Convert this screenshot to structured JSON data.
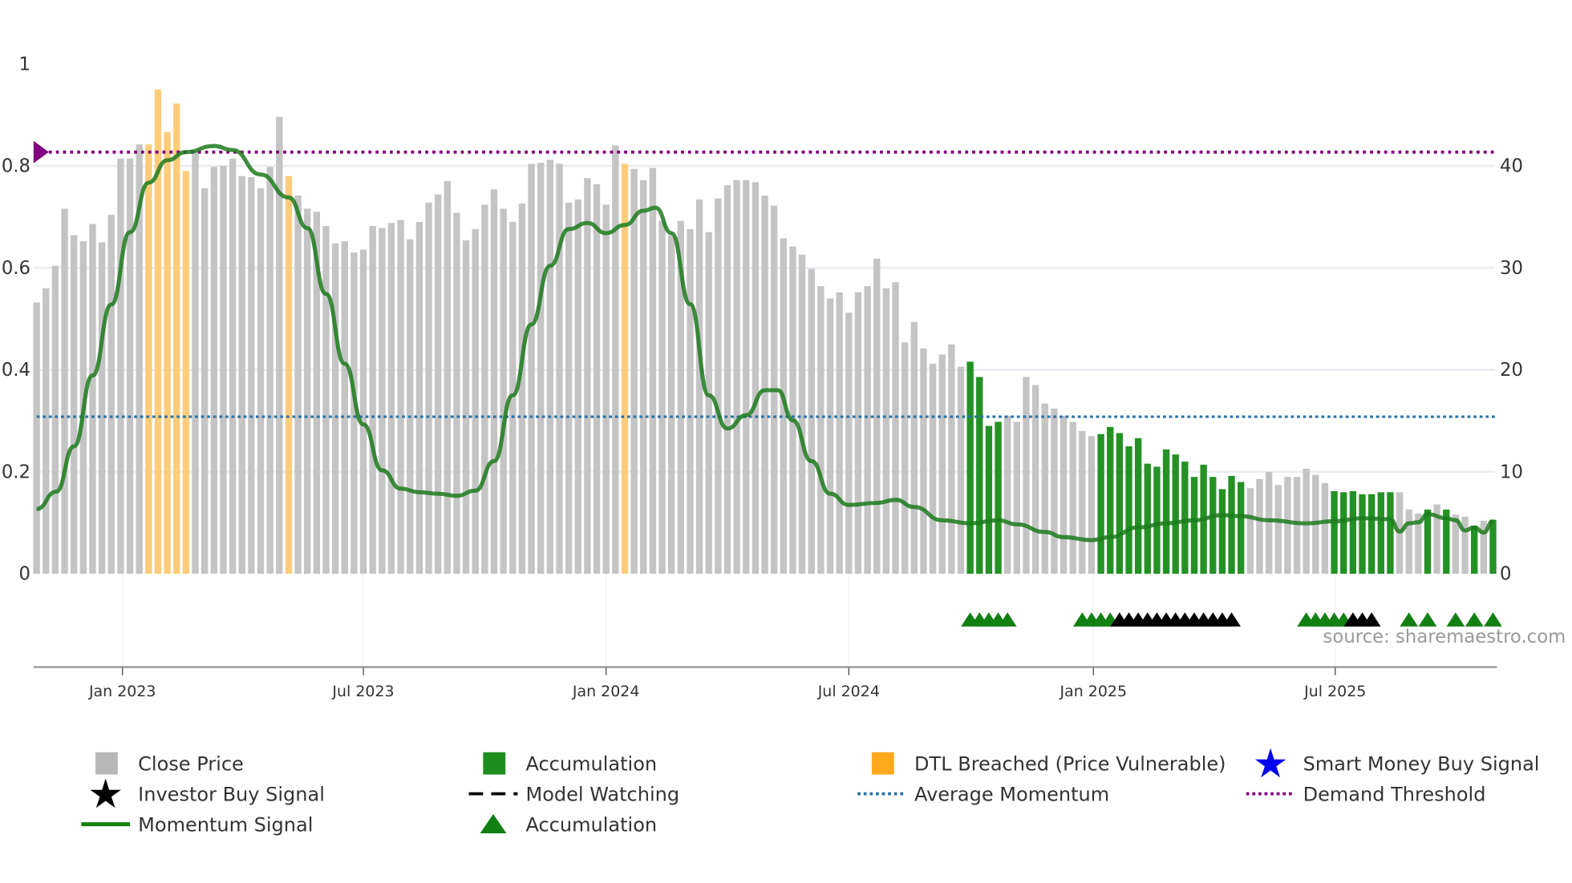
{
  "chart_data": {
    "type": "bar",
    "title": "",
    "source": "source: sharemaestro.com",
    "left_axis": {
      "ylim": [
        0,
        1
      ],
      "ticks": [
        "0",
        "0.2",
        "0.4",
        "0.6",
        "0.8",
        "1"
      ]
    },
    "right_axis": {
      "ylim": [
        0,
        50
      ],
      "ticks": [
        "0",
        "10",
        "20",
        "30",
        "40"
      ]
    },
    "x_axis": {
      "unit": "week index from first bar",
      "ticks": [
        {
          "label": "Jan 2023",
          "x": 9.2
        },
        {
          "label": "Jul 2023",
          "x": 35
        },
        {
          "label": "Jan 2024",
          "x": 61
        },
        {
          "label": "Jul 2024",
          "x": 87
        },
        {
          "label": "Jan 2025",
          "x": 113.2
        },
        {
          "label": "Jul 2025",
          "x": 139.1
        }
      ]
    },
    "close_price": [
      26.6,
      28,
      30.2,
      35.8,
      33.2,
      32.6,
      34.3,
      32.5,
      35.2,
      40.7,
      40.7,
      42.1,
      42.1,
      47.5,
      43.3,
      46.1,
      39.5,
      41.4,
      37.8,
      39.9,
      40,
      40.7,
      39,
      38.9,
      37.8,
      39.9,
      44.8,
      39,
      37.1,
      35.8,
      35.5,
      34.1,
      32.4,
      32.6,
      31.5,
      31.8,
      34.1,
      33.9,
      34.4,
      34.7,
      32.8,
      34.5,
      36.4,
      37.2,
      38.5,
      35.4,
      32.7,
      33.8,
      36.2,
      37.7,
      35.8,
      34.5,
      36.3,
      40.2,
      40.3,
      40.6,
      40.2,
      36.4,
      36.7,
      38.8,
      38.2,
      36.2,
      42,
      40.2,
      39.7,
      38.6,
      39.8,
      34.6,
      33.2,
      34.6,
      33.8,
      36.7,
      33.5,
      36.8,
      38.1,
      38.6,
      38.6,
      38.4,
      37.1,
      36.1,
      32.9,
      32.1,
      31.3,
      29.9,
      28.2,
      27,
      27.6,
      25.6,
      27.6,
      28.2,
      30.9,
      28,
      28.6,
      22.7,
      24.7,
      22.1,
      20.6,
      21.5,
      22.5,
      20.3,
      20.8,
      19.3,
      14.5,
      14.9,
      15.5,
      14.9,
      19.3,
      18.5,
      16.7,
      16.2,
      15.5,
      14.9,
      14,
      13.5,
      13.7,
      14.4,
      13.8,
      12.5,
      13.3,
      10.8,
      10.5,
      12.2,
      11.7,
      11,
      9.5,
      10.7,
      9.5,
      8.3,
      9.6,
      9,
      8.4,
      9.3,
      10,
      8.7,
      9.5,
      9.5,
      10.3,
      9.7,
      8.9,
      8.1,
      8,
      8.1,
      7.8,
      7.8,
      8,
      8,
      8,
      6.3,
      5.9,
      6.3,
      6.8,
      6.3,
      5.8,
      5.6,
      4.7,
      5.2,
      5.3
    ],
    "bar_state": "ggggggggggggdddddggggggggggdgggggggggggggggggggggggggggggggggggdggggggggggggggggggggggggggggggggggggaaaaggggggggggaaaaaaaaaaaaaaaagggggggggaaaaaaagggagaggagaga",
    "momentum": [
      [
        0,
        0.127
      ],
      [
        2.1,
        0.161
      ],
      [
        4,
        0.25
      ],
      [
        6,
        0.389
      ],
      [
        8,
        0.528
      ],
      [
        10,
        0.67
      ],
      [
        12,
        0.767
      ],
      [
        14,
        0.811
      ],
      [
        16,
        0.827
      ],
      [
        19,
        0.839
      ],
      [
        21,
        0.831
      ],
      [
        24,
        0.783
      ],
      [
        27,
        0.738
      ],
      [
        29,
        0.678
      ],
      [
        31,
        0.549
      ],
      [
        33,
        0.412
      ],
      [
        35,
        0.293
      ],
      [
        37,
        0.203
      ],
      [
        39,
        0.167
      ],
      [
        41,
        0.16
      ],
      [
        43,
        0.157
      ],
      [
        45,
        0.153
      ],
      [
        47,
        0.163
      ],
      [
        49,
        0.221
      ],
      [
        51,
        0.35
      ],
      [
        53,
        0.489
      ],
      [
        55,
        0.604
      ],
      [
        57,
        0.676
      ],
      [
        59,
        0.688
      ],
      [
        61,
        0.668
      ],
      [
        63,
        0.684
      ],
      [
        65,
        0.712
      ],
      [
        66.3,
        0.718
      ],
      [
        68,
        0.668
      ],
      [
        70,
        0.529
      ],
      [
        72,
        0.35
      ],
      [
        74,
        0.285
      ],
      [
        76,
        0.311
      ],
      [
        78,
        0.36
      ],
      [
        79.4,
        0.36
      ],
      [
        81,
        0.301
      ],
      [
        83,
        0.221
      ],
      [
        85,
        0.157
      ],
      [
        87,
        0.135
      ],
      [
        90,
        0.139
      ],
      [
        92,
        0.145
      ],
      [
        94,
        0.131
      ],
      [
        97,
        0.105
      ],
      [
        100,
        0.099
      ],
      [
        103,
        0.105
      ],
      [
        105,
        0.097
      ],
      [
        108,
        0.082
      ],
      [
        110,
        0.072
      ],
      [
        113,
        0.066
      ],
      [
        115,
        0.072
      ],
      [
        118,
        0.091
      ],
      [
        121,
        0.099
      ],
      [
        124,
        0.105
      ],
      [
        127,
        0.115
      ],
      [
        129,
        0.113
      ],
      [
        132,
        0.105
      ],
      [
        136,
        0.099
      ],
      [
        139,
        0.103
      ],
      [
        142,
        0.109
      ],
      [
        145,
        0.107
      ],
      [
        146,
        0.083
      ],
      [
        147,
        0.099
      ],
      [
        148,
        0.101
      ],
      [
        149,
        0.117
      ],
      [
        151,
        0.109
      ],
      [
        152,
        0.105
      ],
      [
        153,
        0.085
      ],
      [
        154,
        0.091
      ],
      [
        155,
        0.081
      ],
      [
        156,
        0.103
      ]
    ],
    "average_momentum": 0.308,
    "demand_threshold": 0.827,
    "signals": {
      "accumulation": [
        100,
        101,
        102,
        103,
        104,
        112,
        113,
        114,
        115,
        136,
        137,
        138,
        139,
        140,
        147,
        149,
        152,
        154,
        156
      ],
      "model_watching": [
        116,
        117,
        118,
        119,
        120,
        121,
        122,
        123,
        124,
        125,
        126,
        127,
        128,
        141,
        142,
        143
      ]
    },
    "legend": [
      {
        "label": "Close Price",
        "kind": "bar",
        "color": "#b8b8b8"
      },
      {
        "label": "Accumulation",
        "kind": "bar",
        "color": "#1f8c1f"
      },
      {
        "label": "DTL Breached (Price Vulnerable)",
        "kind": "bar",
        "color": "#ffa81c"
      },
      {
        "label": "Smart Money Buy Signal",
        "kind": "star",
        "color": "#0000ee"
      },
      {
        "label": "Investor Buy Signal",
        "kind": "star",
        "color": "#000000"
      },
      {
        "label": "Model Watching",
        "kind": "dash",
        "color": "#000000"
      },
      {
        "label": "Average Momentum",
        "kind": "dot",
        "color": "#2a74a8"
      },
      {
        "label": "Demand Threshold",
        "kind": "dot",
        "color": "#800080"
      },
      {
        "label": "Momentum Signal",
        "kind": "line",
        "color": "#138013"
      },
      {
        "label": "Accumulation",
        "kind": "triangle",
        "color": "#138013"
      }
    ],
    "legend_placement": "bottom"
  }
}
